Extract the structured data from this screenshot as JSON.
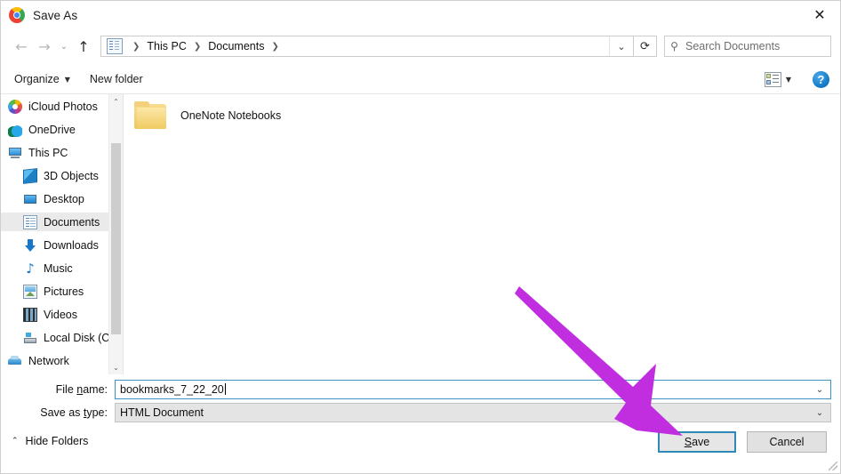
{
  "window": {
    "title": "Save As",
    "app_icon": "chrome-icon",
    "close_label": "✕"
  },
  "nav": {
    "back_icon": "arrow-left-icon",
    "forward_icon": "arrow-right-icon",
    "recent_icon": "chevron-down-icon",
    "up_icon": "arrow-up-icon",
    "address_dropdown_icon": "chevron-down-icon",
    "refresh_icon": "refresh-icon",
    "breadcrumb": [
      "This PC",
      "Documents"
    ],
    "breadcrumb_separator": "❯"
  },
  "search": {
    "placeholder": "Search Documents",
    "icon": "search-icon"
  },
  "toolbar": {
    "organize_label": "Organize",
    "organize_caret": "▼",
    "new_folder_label": "New folder",
    "view_icon": "view-layout-icon",
    "view_caret": "▼",
    "help_label": "?"
  },
  "sidebar": {
    "items": [
      {
        "label": "iCloud Photos",
        "icon": "icloud-photos-icon",
        "level": "root",
        "selected": false
      },
      {
        "label": "OneDrive",
        "icon": "onedrive-cloud-icon",
        "level": "root",
        "selected": false
      },
      {
        "label": "This PC",
        "icon": "this-pc-monitor-icon",
        "level": "root",
        "selected": false
      },
      {
        "label": "3D Objects",
        "icon": "3d-objects-icon",
        "level": "child",
        "selected": false
      },
      {
        "label": "Desktop",
        "icon": "desktop-icon",
        "level": "child",
        "selected": false
      },
      {
        "label": "Documents",
        "icon": "documents-icon",
        "level": "child",
        "selected": true
      },
      {
        "label": "Downloads",
        "icon": "downloads-arrow-icon",
        "level": "child",
        "selected": false
      },
      {
        "label": "Music",
        "icon": "music-note-icon",
        "level": "child",
        "selected": false
      },
      {
        "label": "Pictures",
        "icon": "pictures-icon",
        "level": "child",
        "selected": false
      },
      {
        "label": "Videos",
        "icon": "videos-icon",
        "level": "child",
        "selected": false
      },
      {
        "label": "Local Disk (C:)",
        "icon": "local-disk-icon",
        "level": "child",
        "selected": false
      },
      {
        "label": "Network",
        "icon": "network-icon",
        "level": "root",
        "selected": false
      }
    ],
    "scroll_up_icon": "chevron-up-icon",
    "scroll_down_icon": "chevron-down-icon"
  },
  "files": [
    {
      "name": "OneNote Notebooks",
      "icon": "folder-icon"
    }
  ],
  "form": {
    "filename_label_pre": "File ",
    "filename_label_accel": "n",
    "filename_label_post": "ame:",
    "filename_value": "bookmarks_7_22_20",
    "filetype_label_pre": "Save as ",
    "filetype_label_accel": "t",
    "filetype_label_post": "ype:",
    "filetype_value": "HTML Document",
    "dropdown_icon": "chevron-down-icon"
  },
  "footer": {
    "hide_folders_label": "Hide Folders",
    "hide_folders_icon": "chevron-up-icon",
    "save_label_pre": "",
    "save_label_accel": "S",
    "save_label_post": "ave",
    "cancel_label": "Cancel"
  },
  "annotation": {
    "arrow_color": "#c02ee0",
    "arrow_points_to": "save-button"
  },
  "colors": {
    "focus_border": "#2d8ab5",
    "selection": "#eaeaea",
    "accent_blue": "#1677c8"
  }
}
